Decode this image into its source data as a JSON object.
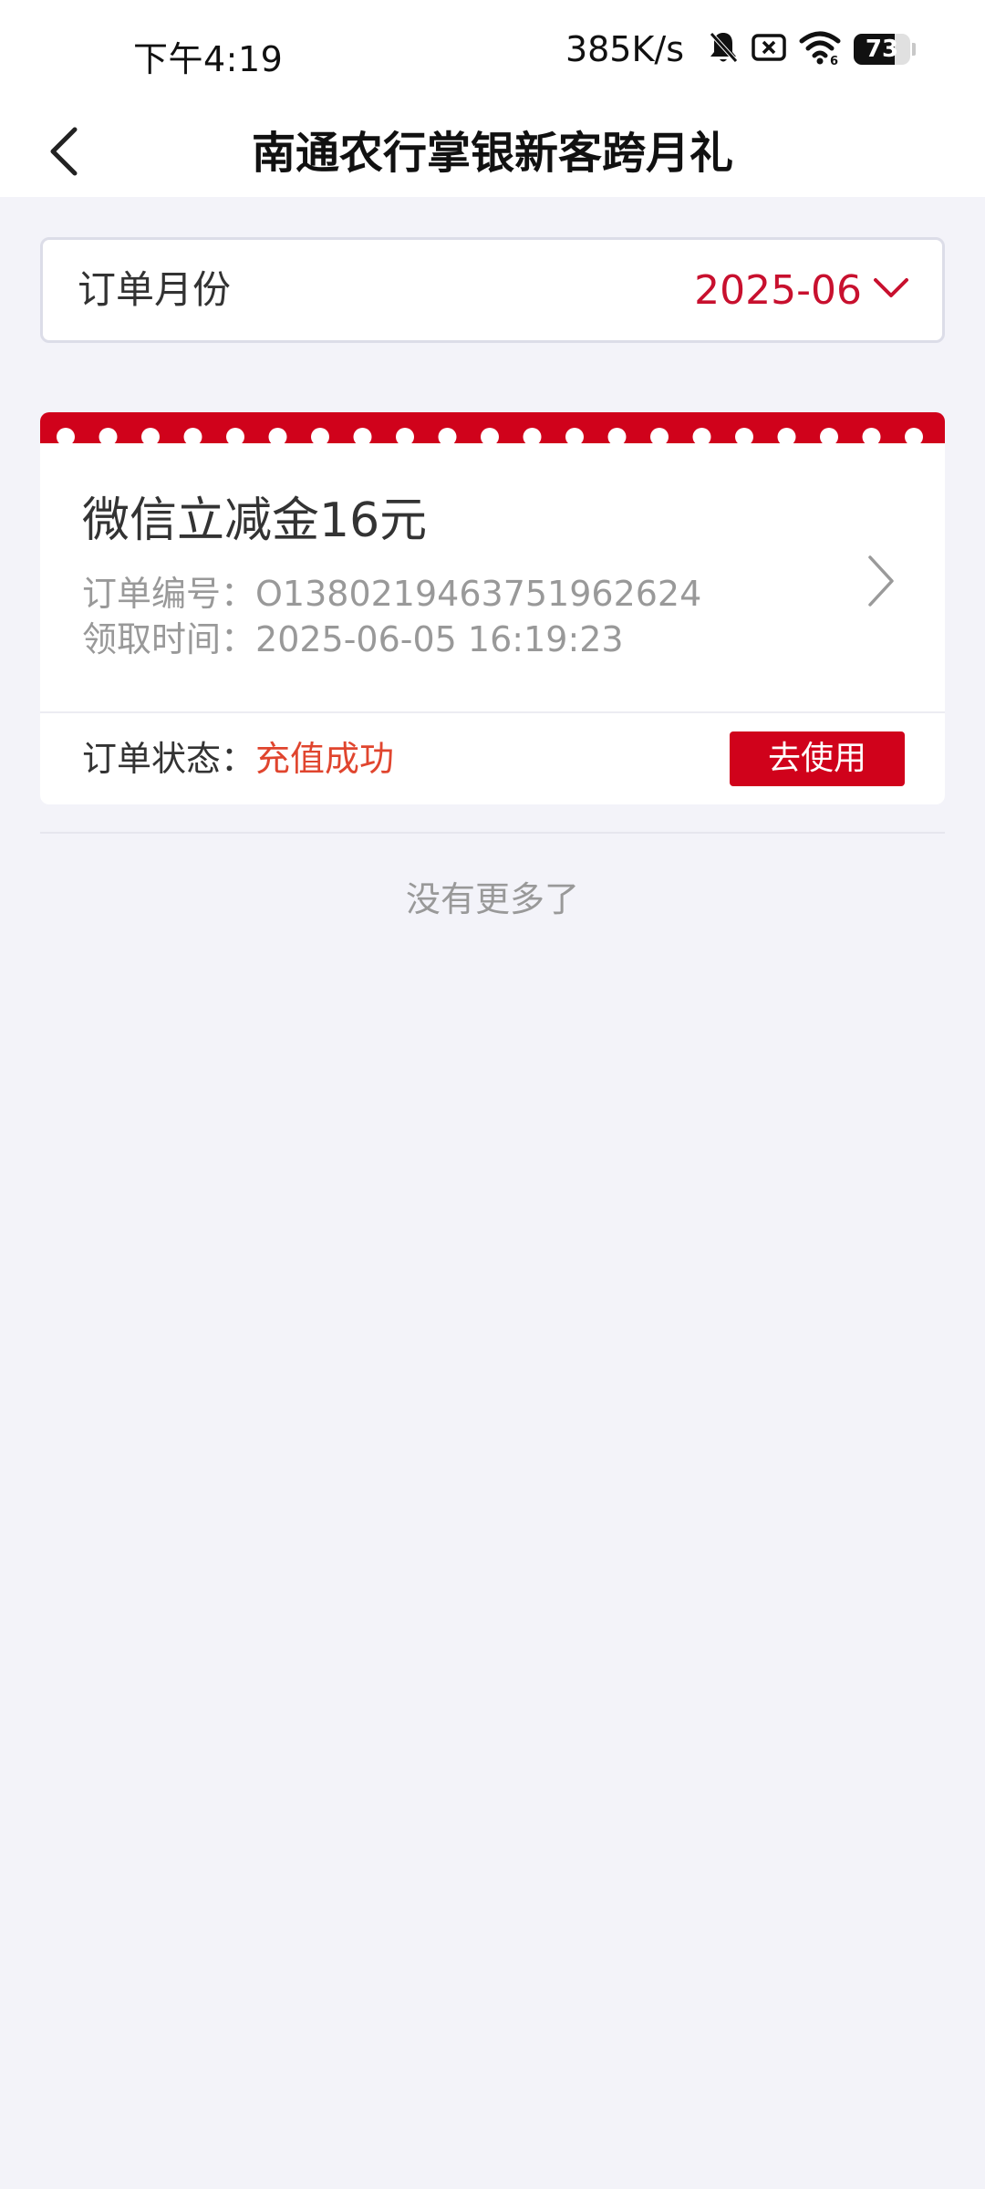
{
  "status_bar": {
    "time": "下午4:19",
    "net_speed": "385K/s",
    "battery_level": "73",
    "icons": [
      "bell-muted-icon",
      "sim-x-icon",
      "wifi-icon",
      "battery-icon"
    ]
  },
  "header": {
    "title": "南通农行掌银新客跨月礼",
    "back_icon": "chevron-left-icon"
  },
  "filter": {
    "label": "订单月份",
    "value": "2025-06",
    "dropdown_icon": "chevron-down-icon"
  },
  "orders": [
    {
      "title": "微信立减金16元",
      "order_no_label": "订单编号：",
      "order_no": "O1380219463751962624",
      "claim_time_label": "领取时间：",
      "claim_time": "2025-06-05 16:19:23",
      "status_label": "订单状态：",
      "status": "充值成功",
      "action_label": "去使用"
    }
  ],
  "list_end_text": "没有更多了",
  "colors": {
    "accent_red": "#c8102e",
    "button_red": "#d0021b",
    "status_orange": "#e0452e",
    "page_bg": "#f3f3f9"
  }
}
